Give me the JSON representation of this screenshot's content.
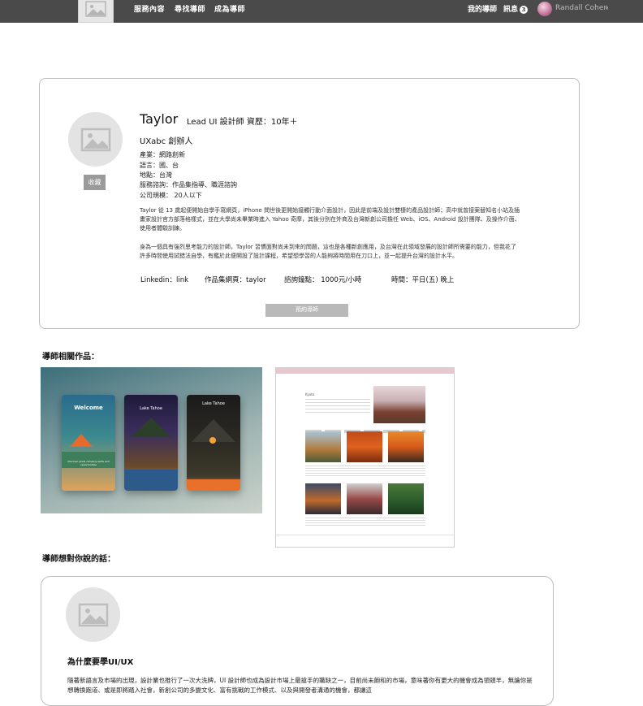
{
  "topbar": {
    "nav": [
      "服務內容",
      "尋找導師",
      "成為導師"
    ],
    "my_mentor": "我的導師",
    "messages_label": "訊息",
    "messages_count": "3",
    "user_name": "Randall Cohen"
  },
  "profile": {
    "name": "Taylor",
    "role": "Lead UI 設計師  資歷：10年＋",
    "company": "UXabc 創辦人",
    "info": [
      "產業：網路創新",
      "語言：國、台",
      "地點：台灣",
      "服務諮詢：作品集指導、職涯諮詢",
      "公司規模： 20人以下"
    ],
    "bio_1": "Taylor 從 13 歲起便開始自學手寫網頁，iPhone 問世後更開始接觸行動介面設計，因此是前端及設計雙棲的產品設計師；高中就曾接案替知名小站及插畫家設計官方部落格樣式，並在大學尚未畢業時進入 Yahoo 奇摩，其後分別在外商及台灣新創公司擔任 Web、iOS、Android 設計團隊、及操作介面、使用者體驗訓練。",
    "bio_2": "身為一個具有強烈思考能力的設計師，Taylor 習慣面對尚未到來的問題，這也是各種新創應用，及台灣在此領域發展的設計師所需要的能力，但我花了許多時間使用試錯法自學，有鑑於此便開設了設計課程，希望想學習的人能夠將時間用在刀口上，並一起提升台灣的設計水平。",
    "links": {
      "linkedin": "Linkedin：link",
      "portfolio": "作品集網頁：taylor",
      "fee": "諮詢鐘點： 1000元/小時",
      "time": "時間：平日(五) 晚上"
    },
    "favorite_button": "收藏",
    "book_button": "預約導師"
  },
  "works_title": "導師相關作品：",
  "works": {
    "app_screens": [
      "Welcome",
      "Lake Tahoe",
      "Lake Tahoe"
    ],
    "app_screen_caption": "Discover great camping spots and opportunities",
    "site_header": "Kyoto"
  },
  "message_title": "導師想對你說的話：",
  "message": {
    "heading": "為什麼要學UI/UX",
    "body": "隨著新語言及市場的出現，設計業也推行了一次大洗牌，UI 設計師也成為設計市場上最搶手的職缺之一，目前尚未飽和的市場，意味著你有更大的機會成為領頭羊，無論你是想轉換跑道、或是即將踏入社會，新創公司的多變文化、富有挑戰的工作模式、以及與開發者溝通的機會，都讓這"
  },
  "colors": {
    "topbar": "#4a4a4a",
    "button": "#9a9a9a",
    "border": "#bdbdbd"
  }
}
